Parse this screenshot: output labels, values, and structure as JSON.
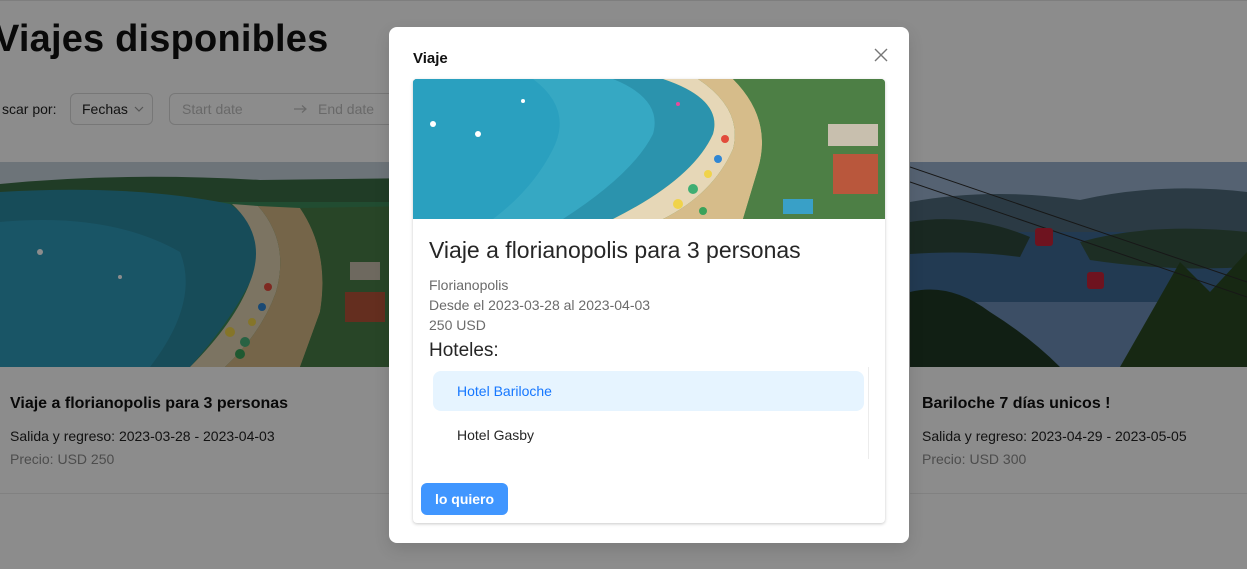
{
  "page": {
    "title": "Viajes disponibles",
    "filter": {
      "label": "scar por:",
      "select_value": "Fechas",
      "start_placeholder": "Start date",
      "end_placeholder": "End date"
    }
  },
  "cards": [
    {
      "title": "Viaje a florianopolis para 3 personas",
      "dates": "Salida y regreso: 2023-03-28 - 2023-04-03",
      "price": "Precio: USD 250"
    },
    {
      "title": "Bariloche 7 días unicos !",
      "dates": "Salida y regreso: 2023-04-29 - 2023-05-05",
      "price": "Precio: USD 300"
    }
  ],
  "modal": {
    "title": "Viaje",
    "heading": "Viaje a florianopolis para 3 personas",
    "city": "Florianopolis",
    "range": "Desde el 2023-03-28 al 2023-04-03",
    "price": "250 USD",
    "hotels_label": "Hoteles:",
    "hotels": [
      {
        "name": "Hotel Bariloche",
        "selected": true
      },
      {
        "name": "Hotel Gasby",
        "selected": false
      }
    ],
    "button_label": "lo quiero"
  },
  "colors": {
    "accent": "#1677ff",
    "button": "#4096ff",
    "selected_bg": "#e6f4ff",
    "mask": "rgba(0,0,0,0.45)"
  },
  "icons": {
    "close": "close-icon",
    "select_chevron": "chevron-down-icon",
    "range_arrow": "arrow-right-icon"
  }
}
